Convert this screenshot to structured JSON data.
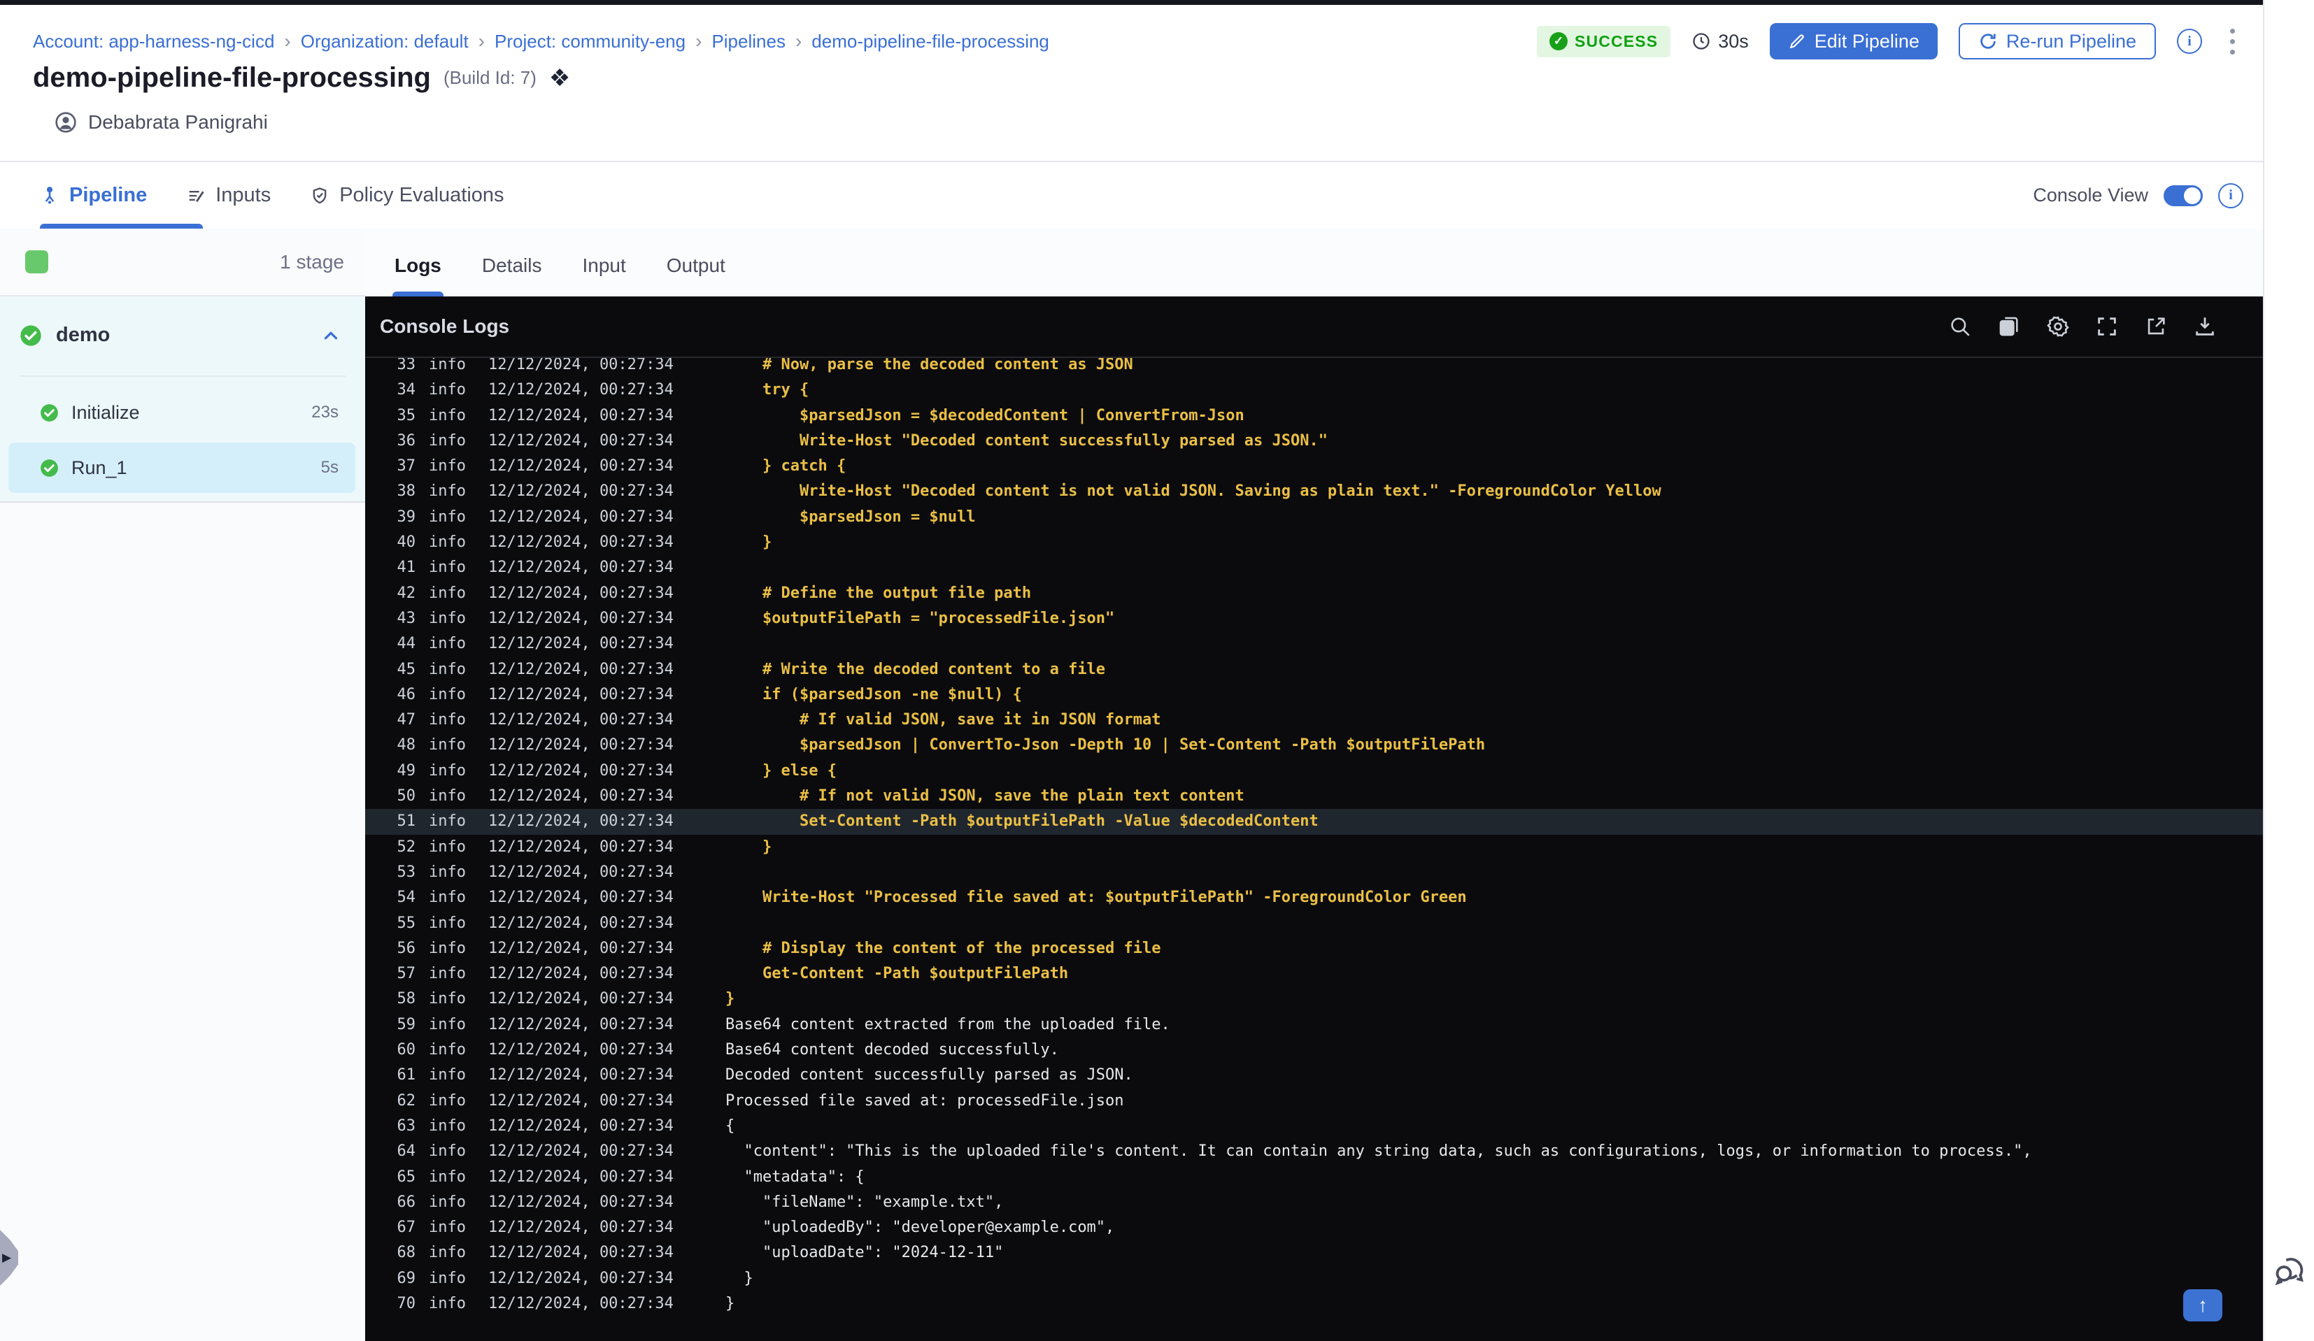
{
  "breadcrumb": {
    "separator": "›",
    "items": [
      "Account: app-harness-ng-cicd",
      "Organization: default",
      "Project: community-eng",
      "Pipelines",
      "demo-pipeline-file-processing"
    ]
  },
  "status": {
    "label": "SUCCESS",
    "duration": "30s"
  },
  "actions": {
    "edit": "Edit Pipeline",
    "rerun": "Re-run Pipeline"
  },
  "title": {
    "name": "demo-pipeline-file-processing",
    "build": "(Build Id: 7)"
  },
  "user": {
    "name": "Debabrata Panigrahi"
  },
  "nav": {
    "tabs": {
      "pipeline": "Pipeline",
      "inputs": "Inputs",
      "policy": "Policy Evaluations"
    },
    "active": "Pipeline",
    "console_view_label": "Console View"
  },
  "sidebar": {
    "stage_count": "1 stage",
    "stage_name": "demo",
    "steps": [
      {
        "label": "Initialize",
        "duration": "23s",
        "selected": false
      },
      {
        "label": "Run_1",
        "duration": "5s",
        "selected": true
      }
    ]
  },
  "log_tabs": {
    "logs": "Logs",
    "details": "Details",
    "input": "Input",
    "output": "Output",
    "active": "Logs"
  },
  "console": {
    "header": "Console Logs",
    "icons": [
      "search",
      "copy",
      "settings",
      "fullscreen",
      "open-in-new",
      "download"
    ],
    "timestamp": "12/12/2024, 00:27:34",
    "level": "info",
    "lines": [
      {
        "n": 33,
        "kind": "code",
        "msg": "    # Now, parse the decoded content as JSON"
      },
      {
        "n": 34,
        "kind": "code",
        "msg": "    try {"
      },
      {
        "n": 35,
        "kind": "code",
        "msg": "        $parsedJson = $decodedContent | ConvertFrom-Json"
      },
      {
        "n": 36,
        "kind": "code",
        "msg": "        Write-Host \"Decoded content successfully parsed as JSON.\""
      },
      {
        "n": 37,
        "kind": "code",
        "msg": "    } catch {"
      },
      {
        "n": 38,
        "kind": "code",
        "msg": "        Write-Host \"Decoded content is not valid JSON. Saving as plain text.\" -ForegroundColor Yellow"
      },
      {
        "n": 39,
        "kind": "code",
        "msg": "        $parsedJson = $null"
      },
      {
        "n": 40,
        "kind": "code",
        "msg": "    }"
      },
      {
        "n": 41,
        "kind": "code",
        "msg": ""
      },
      {
        "n": 42,
        "kind": "code",
        "msg": "    # Define the output file path"
      },
      {
        "n": 43,
        "kind": "code",
        "msg": "    $outputFilePath = \"processedFile.json\""
      },
      {
        "n": 44,
        "kind": "code",
        "msg": ""
      },
      {
        "n": 45,
        "kind": "code",
        "msg": "    # Write the decoded content to a file"
      },
      {
        "n": 46,
        "kind": "code",
        "msg": "    if ($parsedJson -ne $null) {"
      },
      {
        "n": 47,
        "kind": "code",
        "msg": "        # If valid JSON, save it in JSON format"
      },
      {
        "n": 48,
        "kind": "code",
        "msg": "        $parsedJson | ConvertTo-Json -Depth 10 | Set-Content -Path $outputFilePath"
      },
      {
        "n": 49,
        "kind": "code",
        "msg": "    } else {"
      },
      {
        "n": 50,
        "kind": "code",
        "msg": "        # If not valid JSON, save the plain text content"
      },
      {
        "n": 51,
        "kind": "code",
        "msg": "        Set-Content -Path $outputFilePath -Value $decodedContent",
        "highlight": true
      },
      {
        "n": 52,
        "kind": "code",
        "msg": "    }"
      },
      {
        "n": 53,
        "kind": "code",
        "msg": ""
      },
      {
        "n": 54,
        "kind": "code",
        "msg": "    Write-Host \"Processed file saved at: $outputFilePath\" -ForegroundColor Green"
      },
      {
        "n": 55,
        "kind": "code",
        "msg": ""
      },
      {
        "n": 56,
        "kind": "code",
        "msg": "    # Display the content of the processed file"
      },
      {
        "n": 57,
        "kind": "code",
        "msg": "    Get-Content -Path $outputFilePath"
      },
      {
        "n": 58,
        "kind": "code",
        "msg": "}"
      },
      {
        "n": 59,
        "kind": "plain",
        "msg": "Base64 content extracted from the uploaded file."
      },
      {
        "n": 60,
        "kind": "plain",
        "msg": "Base64 content decoded successfully."
      },
      {
        "n": 61,
        "kind": "plain",
        "msg": "Decoded content successfully parsed as JSON."
      },
      {
        "n": 62,
        "kind": "plain",
        "msg": "Processed file saved at: processedFile.json"
      },
      {
        "n": 63,
        "kind": "plain",
        "msg": "{"
      },
      {
        "n": 64,
        "kind": "plain",
        "msg": "  \"content\": \"This is the uploaded file's content. It can contain any string data, such as configurations, logs, or information to process.\","
      },
      {
        "n": 65,
        "kind": "plain",
        "msg": "  \"metadata\": {"
      },
      {
        "n": 66,
        "kind": "plain",
        "msg": "    \"fileName\": \"example.txt\","
      },
      {
        "n": 67,
        "kind": "plain",
        "msg": "    \"uploadedBy\": \"developer@example.com\","
      },
      {
        "n": 68,
        "kind": "plain",
        "msg": "    \"uploadDate\": \"2024-12-11\""
      },
      {
        "n": 69,
        "kind": "plain",
        "msg": "  }"
      },
      {
        "n": 70,
        "kind": "plain",
        "msg": "}"
      }
    ]
  },
  "colors": {
    "accent_blue": "#3a6fd4",
    "success_green": "#12a112",
    "step_green": "#44bb4b",
    "log_yellow": "#eabf45",
    "console_bg": "#0b0b0e",
    "selected_step_bg": "#d5effa"
  }
}
